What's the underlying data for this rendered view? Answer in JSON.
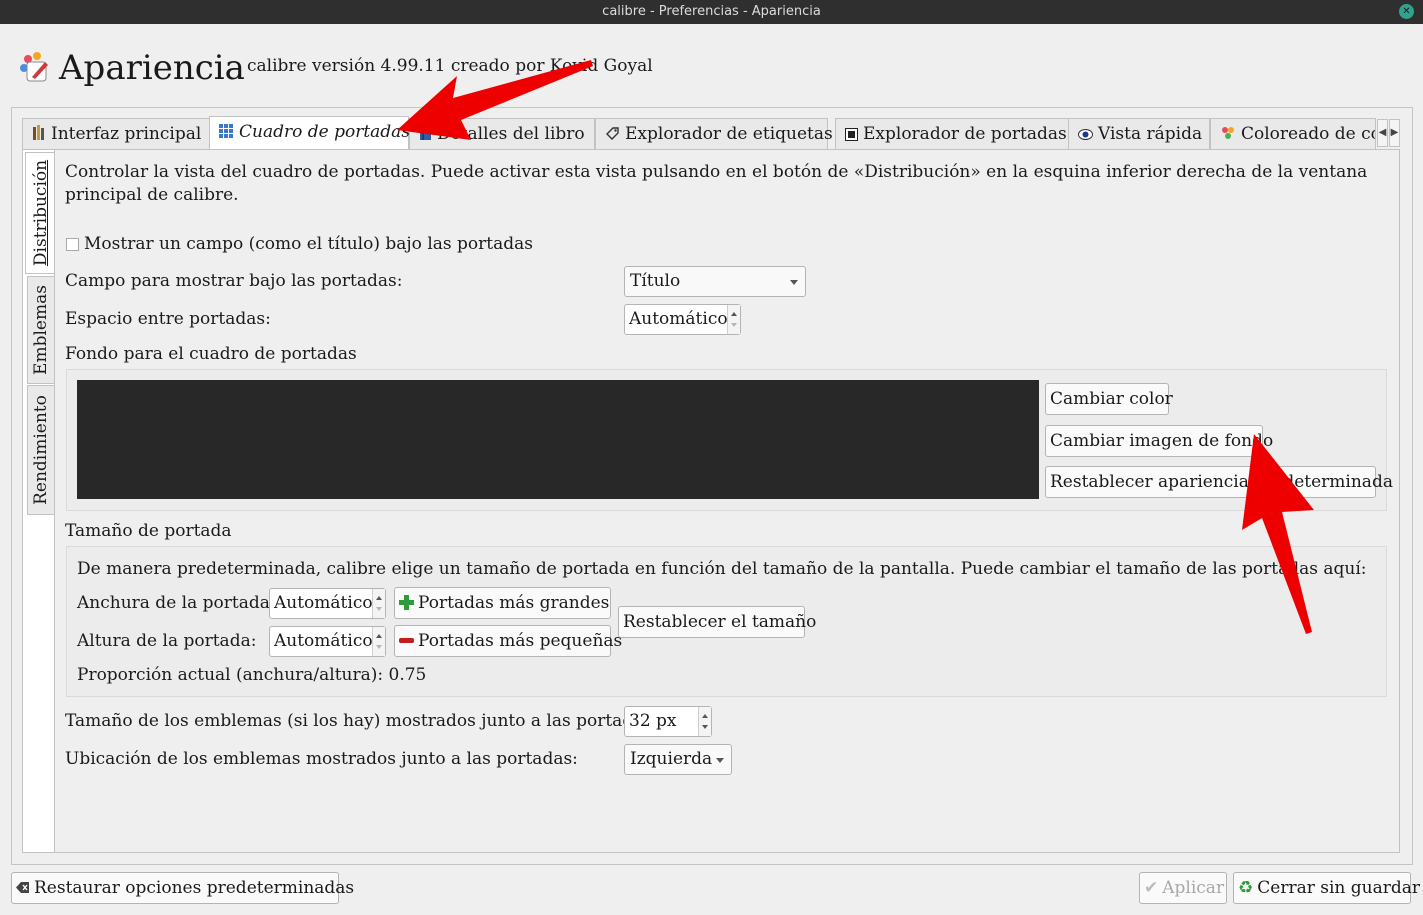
{
  "window": {
    "title": "calibre - Preferencias - Apariencia"
  },
  "header": {
    "title": "Apariencia",
    "version": "calibre versión 4.99.11 creado por Kovid Goyal"
  },
  "tabs": [
    {
      "label": "Interfaz principal",
      "icon": "books-icon"
    },
    {
      "label": "Cuadro de portadas",
      "icon": "grid-icon",
      "active": true
    },
    {
      "label": "Detalles del libro",
      "icon": "book-icon"
    },
    {
      "label": "Explorador de etiquetas",
      "icon": "tag-icon"
    },
    {
      "label": "Explorador de portadas",
      "icon": "cover-icon"
    },
    {
      "label": "Vista rápida",
      "icon": "eye-icon"
    },
    {
      "label": "Coloreado de co",
      "icon": "palette-icon"
    }
  ],
  "side_tabs": [
    {
      "label": "Distribución",
      "active": true
    },
    {
      "label": "Emblemas"
    },
    {
      "label": "Rendimiento"
    }
  ],
  "layout": {
    "description": "Controlar la vista del cuadro de portadas. Puede activar esta vista pulsando en el botón de «Distribución» en la esquina inferior derecha de la ventana principal de calibre.",
    "show_field_checkbox": {
      "label": "Mostrar un campo (como el título) bajo las portadas",
      "checked": false
    },
    "field_label": "Campo para mostrar bajo las portadas:",
    "field_value": "Título",
    "spacing_label": "Espacio entre portadas:",
    "spacing_value": "Automático",
    "background_heading": "Fondo para el cuadro de portadas",
    "background_color": "#282828",
    "change_color_button": "Cambiar color",
    "change_image_button": "Cambiar imagen de fondo",
    "reset_appearance_button": "Restablecer apariencia predeterminada",
    "cover_size_heading": "Tamaño de portada",
    "cover_size_description": "De manera predeterminada, calibre elige un tamaño de portada en función del tamaño de la pantalla. Puede cambiar el tamaño de las portadas aquí:",
    "width_label": "Anchura de la portada:",
    "width_value": "Automático",
    "height_label": "Altura de la portada:",
    "height_value": "Automático",
    "larger_button": "Portadas más grandes",
    "smaller_button": "Portadas más pequeñas",
    "reset_size_button": "Restablecer el tamaño",
    "ratio_text": "Proporción actual (anchura/altura): 0.75",
    "emblem_size_label": "Tamaño de los emblemas (si los hay) mostrados junto a las portadas:",
    "emblem_size_value": "32 px",
    "emblem_location_label": "Ubicación de los emblemas mostrados junto a las portadas:",
    "emblem_location_value": "Izquierda"
  },
  "footer": {
    "restore_button": "Restaurar opciones predeterminadas",
    "apply_button": "Aplicar",
    "close_button": "Cerrar sin guardar"
  },
  "colors": {
    "annotation_arrow": "#ee0000",
    "titlebar": "#2f2f2f"
  }
}
